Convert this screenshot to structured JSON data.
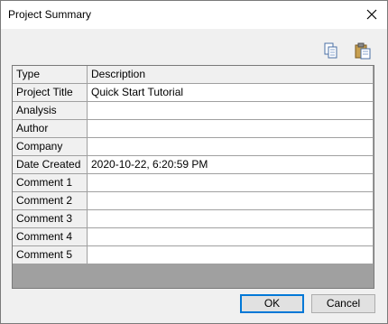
{
  "window": {
    "title": "Project Summary"
  },
  "toolbar": {
    "copy_icon": "copy-icon",
    "paste_icon": "paste-icon"
  },
  "table": {
    "headers": [
      "Type",
      "Description"
    ],
    "rows": [
      {
        "type": "Project Title",
        "description": "Quick Start Tutorial"
      },
      {
        "type": "Analysis",
        "description": ""
      },
      {
        "type": "Author",
        "description": ""
      },
      {
        "type": "Company",
        "description": ""
      },
      {
        "type": "Date Created",
        "description": "2020-10-22, 6:20:59 PM"
      },
      {
        "type": "Comment 1",
        "description": ""
      },
      {
        "type": "Comment 2",
        "description": ""
      },
      {
        "type": "Comment 3",
        "description": ""
      },
      {
        "type": "Comment 4",
        "description": ""
      },
      {
        "type": "Comment 5",
        "description": ""
      }
    ]
  },
  "buttons": {
    "ok": "OK",
    "cancel": "Cancel"
  },
  "colors": {
    "accent": "#0078d7",
    "grid_background": "#a0a0a0"
  }
}
